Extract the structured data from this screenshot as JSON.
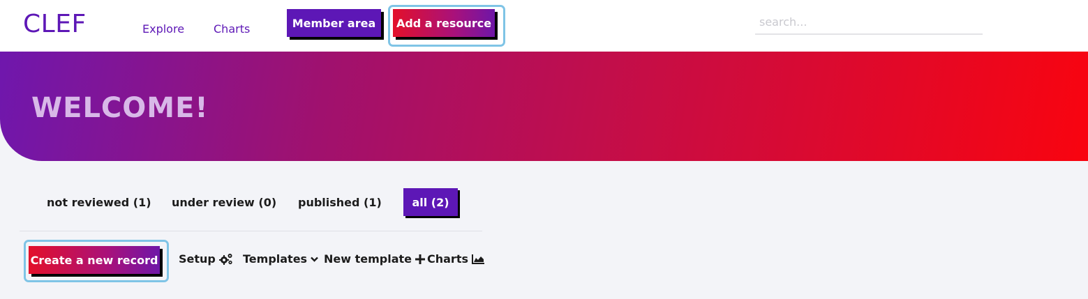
{
  "header": {
    "logo": "CLEF",
    "nav": {
      "explore": "Explore",
      "charts": "Charts"
    },
    "member_area": "Member area",
    "add_resource": "Add a resource",
    "search_placeholder": "search..."
  },
  "hero": {
    "title": "WELCOME!"
  },
  "tabs": {
    "not_reviewed": "not reviewed (1)",
    "under_review": "under review (0)",
    "published": "published (1)",
    "all": "all (2)"
  },
  "toolbar": {
    "create": "Create a new record",
    "setup": "Setup",
    "templates": "Templates",
    "new_template": "New template",
    "charts": "Charts"
  },
  "icons": {
    "setup": "cogs-icon",
    "templates": "chevron-down-icon",
    "new_template": "plus-icon",
    "charts": "area-chart-icon"
  },
  "colors": {
    "brand_purple": "#5d17b6",
    "brand_red": "#e3102a",
    "focus_ring": "#7fc4e6",
    "background": "#f3f4f8"
  }
}
